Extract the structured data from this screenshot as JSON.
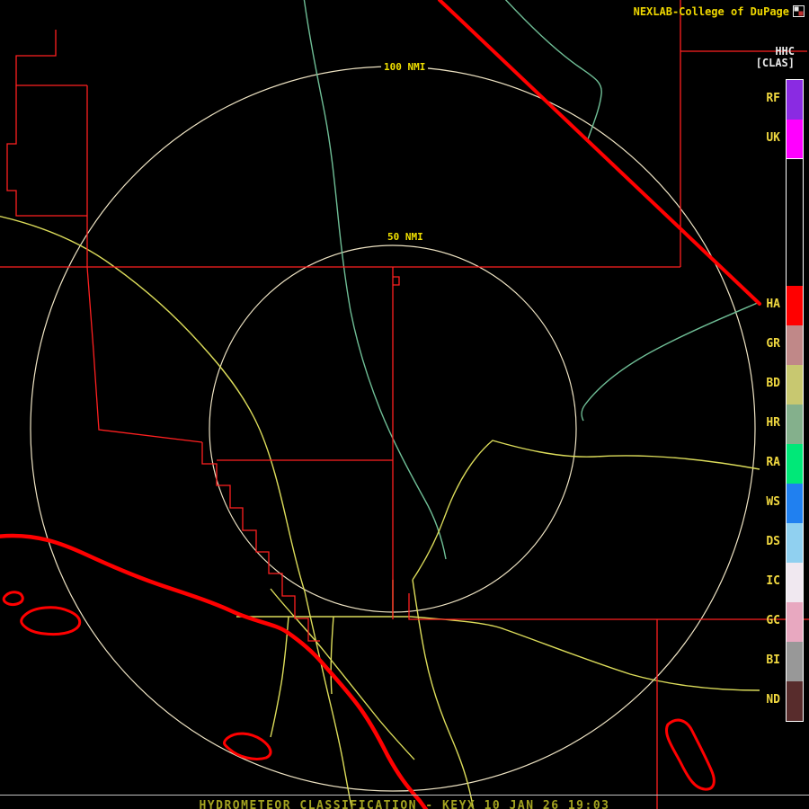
{
  "header": {
    "title": "NEXLAB-College of DuPage",
    "product_code": "HHC",
    "product_mode": "[CLAS]"
  },
  "rings": {
    "outer_label": "100 NMI",
    "inner_label": "50 NMI"
  },
  "legend": {
    "items": [
      {
        "label": "RF",
        "color": "#8A2BE2"
      },
      {
        "label": "UK",
        "color": "#FF00FF",
        "tick": true
      },
      {
        "label": "",
        "color": "#000000",
        "gap": true
      },
      {
        "label": "HA",
        "color": "#FF0000"
      },
      {
        "label": "GR",
        "color": "#C08888"
      },
      {
        "label": "BD",
        "color": "#C8C870"
      },
      {
        "label": "HR",
        "color": "#84B08C"
      },
      {
        "label": "RA",
        "color": "#00E878"
      },
      {
        "label": "WS",
        "color": "#2080F0"
      },
      {
        "label": "DS",
        "color": "#90D0F0"
      },
      {
        "label": "IC",
        "color": "#F0E8F0"
      },
      {
        "label": "GC",
        "color": "#E8A8C0"
      },
      {
        "label": "BI",
        "color": "#989898"
      },
      {
        "label": "ND",
        "color": "#582C2C"
      }
    ]
  },
  "map": {
    "colors": {
      "county_lines": "#FF2020",
      "state_line": "#FF0000",
      "coastline": "#FF0000",
      "roads": "#DCDC5A",
      "rivers": "#6FBE96",
      "range_rings": "#EFE4C4"
    }
  },
  "footer": {
    "caption": "HYDROMETEOR CLASSIFICATION - KEYX 10 JAN 26 19:03"
  }
}
